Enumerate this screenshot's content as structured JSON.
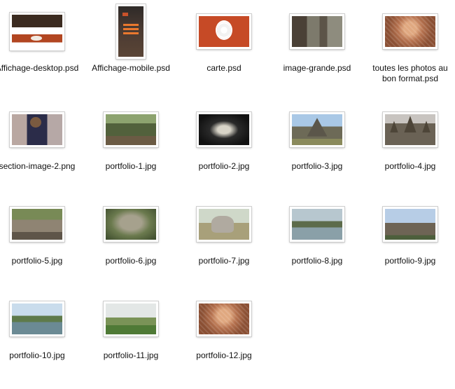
{
  "files": [
    {
      "name": "Affichage-desktop.psd",
      "kind": "ph-desktop",
      "shape": "t-land"
    },
    {
      "name": "Affichage-mobile.psd",
      "kind": "ph-mobile",
      "shape": "t-port"
    },
    {
      "name": "carte.psd",
      "kind": "ph-carte",
      "shape": "t-wide"
    },
    {
      "name": "image-grande.psd",
      "kind": "ph-grande",
      "shape": "t-wide"
    },
    {
      "name": "toutes les photos au bon format.psd",
      "kind": "ph-stone",
      "shape": "t-wide"
    },
    {
      "name": "section-image-2.png",
      "kind": "ph-person",
      "shape": "t-wide"
    },
    {
      "name": "portfolio-1.jpg",
      "kind": "ph-forest",
      "shape": "t-wide"
    },
    {
      "name": "portfolio-2.jpg",
      "kind": "ph-door",
      "shape": "t-wide"
    },
    {
      "name": "portfolio-3.jpg",
      "kind": "ph-temple",
      "shape": "t-wide"
    },
    {
      "name": "portfolio-4.jpg",
      "kind": "ph-towers",
      "shape": "t-wide"
    },
    {
      "name": "portfolio-5.jpg",
      "kind": "ph-ruin",
      "shape": "t-wide"
    },
    {
      "name": "portfolio-6.jpg",
      "kind": "ph-face",
      "shape": "t-wide"
    },
    {
      "name": "portfolio-7.jpg",
      "kind": "ph-elephant",
      "shape": "t-wide"
    },
    {
      "name": "portfolio-8.jpg",
      "kind": "ph-swamp",
      "shape": "t-wide"
    },
    {
      "name": "portfolio-9.jpg",
      "kind": "ph-angkor",
      "shape": "t-wide"
    },
    {
      "name": "portfolio-10.jpg",
      "kind": "ph-lake",
      "shape": "t-wide"
    },
    {
      "name": "portfolio-11.jpg",
      "kind": "ph-field",
      "shape": "t-wide"
    },
    {
      "name": "portfolio-12.jpg",
      "kind": "ph-stone",
      "shape": "t-wide"
    }
  ]
}
